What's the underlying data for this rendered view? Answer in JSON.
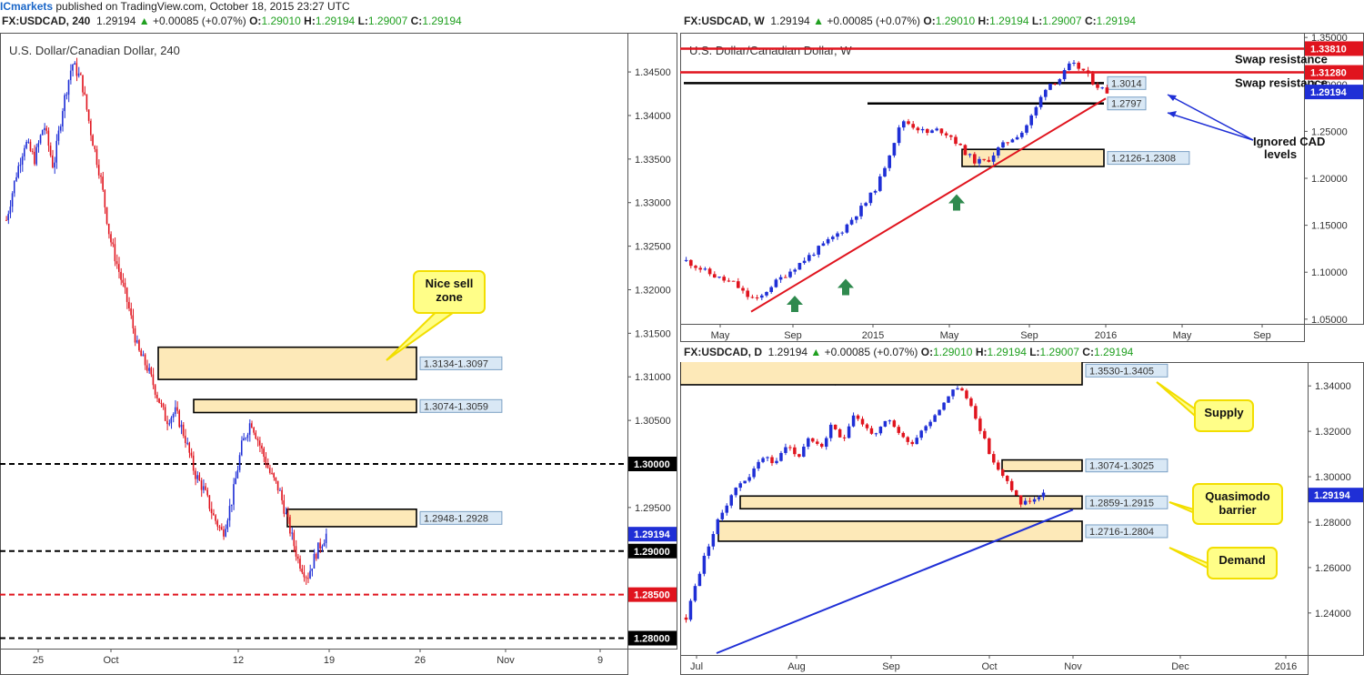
{
  "publisher": {
    "brand": "ICmarkets",
    "text": " published on TradingView.com, October 18, 2015 23:27 UTC"
  },
  "charts_header": [
    {
      "symbol": "FX:USDCAD, 240",
      "price": "1.29194",
      "arrow": "▲",
      "change": "+0.00085 (+0.07%)",
      "o": "1.29010",
      "h": "1.29194",
      "l": "1.29007",
      "c": "1.29194"
    },
    {
      "symbol": "FX:USDCAD, W",
      "price": "1.29194",
      "arrow": "▲",
      "change": "+0.00085 (+0.07%)",
      "o": "1.29010",
      "h": "1.29194",
      "l": "1.29007",
      "c": "1.29194"
    },
    {
      "symbol": "FX:USDCAD, D",
      "price": "1.29194",
      "arrow": "▲",
      "change": "+0.00085 (+0.07%)",
      "o": "1.29010",
      "h": "1.29194",
      "l": "1.29007",
      "c": "1.29194"
    }
  ],
  "colors": {
    "up": "#1f2fd6",
    "down": "#e0141e",
    "zone_fill": "#fde9b8",
    "callout": "#fffe88",
    "callout_border": "#f2de00"
  },
  "chart_data": [
    {
      "type": "candlestick",
      "title": "U.S. Dollar/Canadian Dollar, 240",
      "ylim": [
        1.2788,
        1.3495
      ],
      "y_ticks": [
        "1.34500",
        "1.34000",
        "1.33500",
        "1.33000",
        "1.32500",
        "1.32000",
        "1.31500",
        "1.31000",
        "1.30500",
        "1.30000",
        "1.29500",
        "1.29000",
        "1.28500",
        "1.28000"
      ],
      "x_ticks": [
        "25",
        "Oct",
        "12",
        "19",
        "26",
        "Nov",
        "9"
      ],
      "last_price": "1.29194",
      "levels": [
        {
          "value": 1.3,
          "label": "1.30000",
          "style": "black"
        },
        {
          "value": 1.29,
          "label": "1.29000",
          "style": "black"
        },
        {
          "value": 1.285,
          "label": "1.28500",
          "style": "red"
        },
        {
          "value": 1.28,
          "label": "1.28000",
          "style": "black"
        }
      ],
      "zones": [
        {
          "label": "1.3134-1.3097",
          "top": 1.3134,
          "bottom": 1.3097
        },
        {
          "label": "1.3074-1.3059",
          "top": 1.3074,
          "bottom": 1.3059
        },
        {
          "label": "1.2948-1.2928",
          "top": 1.2948,
          "bottom": 1.2928
        }
      ],
      "callouts": [
        {
          "text": "Nice sell zone"
        }
      ],
      "close_path": [
        1.328,
        1.333,
        1.337,
        1.335,
        1.339,
        1.334,
        1.341,
        1.346,
        1.344,
        1.338,
        1.333,
        1.326,
        1.322,
        1.318,
        1.313,
        1.311,
        1.308,
        1.305,
        1.306,
        1.303,
        1.299,
        1.297,
        1.294,
        1.292,
        1.296,
        1.302,
        1.305,
        1.302,
        1.299,
        1.297,
        1.293,
        1.289,
        1.287,
        1.29,
        1.2919
      ]
    },
    {
      "type": "candlestick",
      "title": "U.S. Dollar/Canadian Dollar, W",
      "ylim": [
        1.045,
        1.355
      ],
      "y_ticks": [
        "1.35000",
        "1.30000",
        "1.25000",
        "1.20000",
        "1.15000",
        "1.10000",
        "1.05000"
      ],
      "x_ticks": [
        "May",
        "Sep",
        "2015",
        "May",
        "Sep",
        "2016",
        "May",
        "Sep"
      ],
      "last_price": "1.29194",
      "levels": [
        {
          "value": 1.3381,
          "label": "1.33810",
          "style": "red"
        },
        {
          "value": 1.3128,
          "label": "1.31280",
          "style": "red"
        }
      ],
      "level_texts": [
        "Swap resistance",
        "Swap resistance"
      ],
      "support_labels": [
        "1.3014",
        "1.2797"
      ],
      "zones": [
        {
          "label": "1.2126-1.2308",
          "top": 1.2308,
          "bottom": 1.2126
        }
      ],
      "callouts": [
        {
          "text": "Ignored CAD levels"
        }
      ],
      "close_path": [
        1.112,
        1.105,
        1.098,
        1.092,
        1.088,
        1.075,
        1.07,
        1.085,
        1.095,
        1.105,
        1.115,
        1.125,
        1.135,
        1.145,
        1.16,
        1.175,
        1.195,
        1.23,
        1.262,
        1.255,
        1.248,
        1.252,
        1.245,
        1.23,
        1.218,
        1.218,
        1.232,
        1.242,
        1.25,
        1.272,
        1.3,
        1.305,
        1.322,
        1.315,
        1.3,
        1.292
      ]
    },
    {
      "type": "candlestick",
      "title": "U.S. Dollar/Canadian Dollar, D",
      "ylim": [
        1.2215,
        1.3505
      ],
      "y_ticks": [
        "1.34000",
        "1.32000",
        "1.30000",
        "1.28000",
        "1.26000",
        "1.24000"
      ],
      "x_ticks": [
        "Jul",
        "Aug",
        "Sep",
        "Oct",
        "Nov",
        "Dec",
        "2016"
      ],
      "last_price": "1.29194",
      "zones": [
        {
          "label": "1.3530-1.3405",
          "top": 1.353,
          "bottom": 1.3405
        },
        {
          "label": "1.3074-1.3025",
          "top": 1.3074,
          "bottom": 1.3025
        },
        {
          "label": "1.2859-1.2915",
          "top": 1.2915,
          "bottom": 1.2859
        },
        {
          "label": "1.2716-1.2804",
          "top": 1.2804,
          "bottom": 1.2716
        }
      ],
      "callouts": [
        {
          "text": "Supply"
        },
        {
          "text": "Quasimodo barrier"
        },
        {
          "text": "Demand"
        }
      ],
      "close_path": [
        1.238,
        1.255,
        1.27,
        1.282,
        1.292,
        1.298,
        1.302,
        1.31,
        1.305,
        1.315,
        1.308,
        1.318,
        1.312,
        1.322,
        1.316,
        1.328,
        1.322,
        1.318,
        1.325,
        1.32,
        1.314,
        1.32,
        1.326,
        1.332,
        1.34,
        1.336,
        1.326,
        1.312,
        1.302,
        1.296,
        1.288,
        1.29,
        1.2919
      ]
    }
  ]
}
